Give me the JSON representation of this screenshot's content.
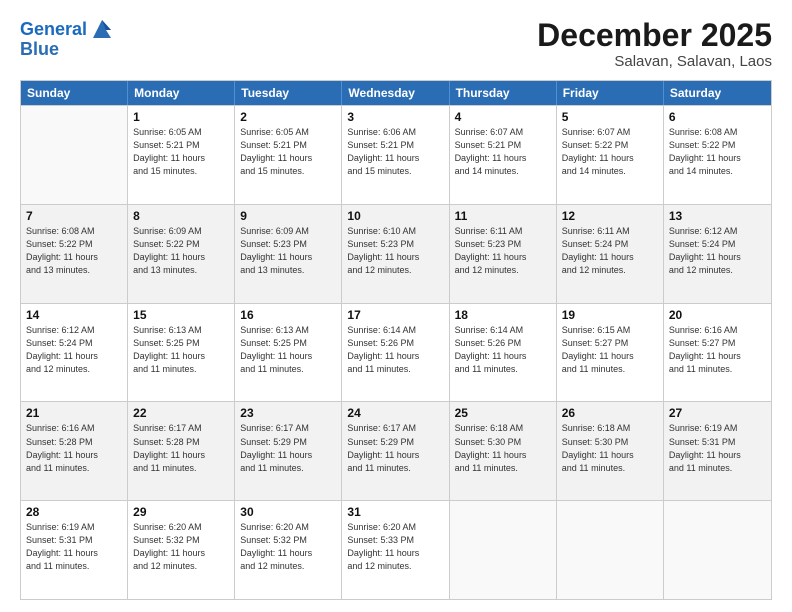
{
  "logo": {
    "line1": "General",
    "line2": "Blue"
  },
  "title": "December 2025",
  "location": "Salavan, Salavan, Laos",
  "headers": [
    "Sunday",
    "Monday",
    "Tuesday",
    "Wednesday",
    "Thursday",
    "Friday",
    "Saturday"
  ],
  "rows": [
    [
      {
        "day": "",
        "info": ""
      },
      {
        "day": "1",
        "info": "Sunrise: 6:05 AM\nSunset: 5:21 PM\nDaylight: 11 hours\nand 15 minutes."
      },
      {
        "day": "2",
        "info": "Sunrise: 6:05 AM\nSunset: 5:21 PM\nDaylight: 11 hours\nand 15 minutes."
      },
      {
        "day": "3",
        "info": "Sunrise: 6:06 AM\nSunset: 5:21 PM\nDaylight: 11 hours\nand 15 minutes."
      },
      {
        "day": "4",
        "info": "Sunrise: 6:07 AM\nSunset: 5:21 PM\nDaylight: 11 hours\nand 14 minutes."
      },
      {
        "day": "5",
        "info": "Sunrise: 6:07 AM\nSunset: 5:22 PM\nDaylight: 11 hours\nand 14 minutes."
      },
      {
        "day": "6",
        "info": "Sunrise: 6:08 AM\nSunset: 5:22 PM\nDaylight: 11 hours\nand 14 minutes."
      }
    ],
    [
      {
        "day": "7",
        "info": "Sunrise: 6:08 AM\nSunset: 5:22 PM\nDaylight: 11 hours\nand 13 minutes."
      },
      {
        "day": "8",
        "info": "Sunrise: 6:09 AM\nSunset: 5:22 PM\nDaylight: 11 hours\nand 13 minutes."
      },
      {
        "day": "9",
        "info": "Sunrise: 6:09 AM\nSunset: 5:23 PM\nDaylight: 11 hours\nand 13 minutes."
      },
      {
        "day": "10",
        "info": "Sunrise: 6:10 AM\nSunset: 5:23 PM\nDaylight: 11 hours\nand 12 minutes."
      },
      {
        "day": "11",
        "info": "Sunrise: 6:11 AM\nSunset: 5:23 PM\nDaylight: 11 hours\nand 12 minutes."
      },
      {
        "day": "12",
        "info": "Sunrise: 6:11 AM\nSunset: 5:24 PM\nDaylight: 11 hours\nand 12 minutes."
      },
      {
        "day": "13",
        "info": "Sunrise: 6:12 AM\nSunset: 5:24 PM\nDaylight: 11 hours\nand 12 minutes."
      }
    ],
    [
      {
        "day": "14",
        "info": "Sunrise: 6:12 AM\nSunset: 5:24 PM\nDaylight: 11 hours\nand 12 minutes."
      },
      {
        "day": "15",
        "info": "Sunrise: 6:13 AM\nSunset: 5:25 PM\nDaylight: 11 hours\nand 11 minutes."
      },
      {
        "day": "16",
        "info": "Sunrise: 6:13 AM\nSunset: 5:25 PM\nDaylight: 11 hours\nand 11 minutes."
      },
      {
        "day": "17",
        "info": "Sunrise: 6:14 AM\nSunset: 5:26 PM\nDaylight: 11 hours\nand 11 minutes."
      },
      {
        "day": "18",
        "info": "Sunrise: 6:14 AM\nSunset: 5:26 PM\nDaylight: 11 hours\nand 11 minutes."
      },
      {
        "day": "19",
        "info": "Sunrise: 6:15 AM\nSunset: 5:27 PM\nDaylight: 11 hours\nand 11 minutes."
      },
      {
        "day": "20",
        "info": "Sunrise: 6:16 AM\nSunset: 5:27 PM\nDaylight: 11 hours\nand 11 minutes."
      }
    ],
    [
      {
        "day": "21",
        "info": "Sunrise: 6:16 AM\nSunset: 5:28 PM\nDaylight: 11 hours\nand 11 minutes."
      },
      {
        "day": "22",
        "info": "Sunrise: 6:17 AM\nSunset: 5:28 PM\nDaylight: 11 hours\nand 11 minutes."
      },
      {
        "day": "23",
        "info": "Sunrise: 6:17 AM\nSunset: 5:29 PM\nDaylight: 11 hours\nand 11 minutes."
      },
      {
        "day": "24",
        "info": "Sunrise: 6:17 AM\nSunset: 5:29 PM\nDaylight: 11 hours\nand 11 minutes."
      },
      {
        "day": "25",
        "info": "Sunrise: 6:18 AM\nSunset: 5:30 PM\nDaylight: 11 hours\nand 11 minutes."
      },
      {
        "day": "26",
        "info": "Sunrise: 6:18 AM\nSunset: 5:30 PM\nDaylight: 11 hours\nand 11 minutes."
      },
      {
        "day": "27",
        "info": "Sunrise: 6:19 AM\nSunset: 5:31 PM\nDaylight: 11 hours\nand 11 minutes."
      }
    ],
    [
      {
        "day": "28",
        "info": "Sunrise: 6:19 AM\nSunset: 5:31 PM\nDaylight: 11 hours\nand 11 minutes."
      },
      {
        "day": "29",
        "info": "Sunrise: 6:20 AM\nSunset: 5:32 PM\nDaylight: 11 hours\nand 12 minutes."
      },
      {
        "day": "30",
        "info": "Sunrise: 6:20 AM\nSunset: 5:32 PM\nDaylight: 11 hours\nand 12 minutes."
      },
      {
        "day": "31",
        "info": "Sunrise: 6:20 AM\nSunset: 5:33 PM\nDaylight: 11 hours\nand 12 minutes."
      },
      {
        "day": "",
        "info": ""
      },
      {
        "day": "",
        "info": ""
      },
      {
        "day": "",
        "info": ""
      }
    ]
  ]
}
